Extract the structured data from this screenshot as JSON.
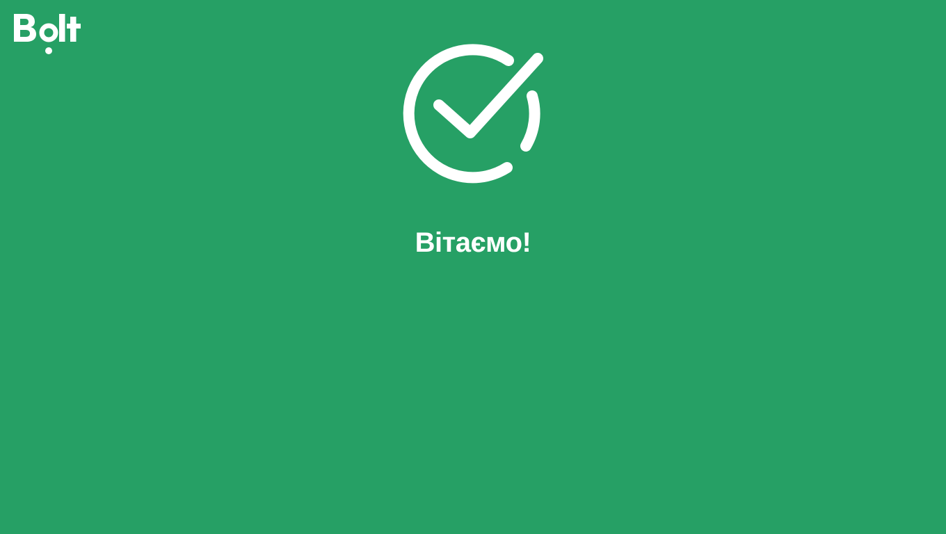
{
  "brand": {
    "logo_text": "Bolt",
    "logo_icon": "bolt-logo",
    "color": "#ffffff"
  },
  "background_color": "#26a065",
  "status": {
    "icon": "check-circle-icon",
    "title": "Вітаємо!"
  }
}
